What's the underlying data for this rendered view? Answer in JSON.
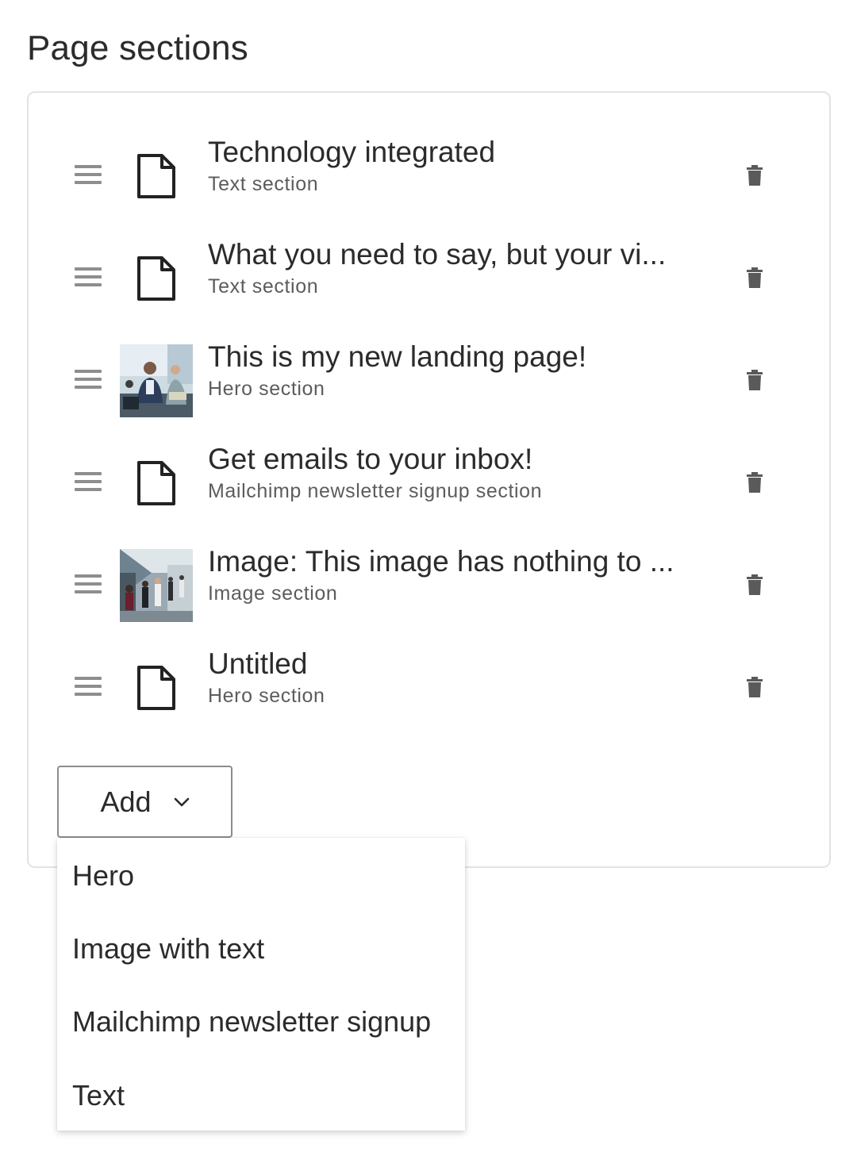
{
  "page_title": "Page sections",
  "sections": [
    {
      "title": "Technology integrated",
      "type": "Text section",
      "thumb": "page-icon"
    },
    {
      "title": "What you need to say, but your vi...",
      "type": "Text section",
      "thumb": "page-icon"
    },
    {
      "title": "This is my new landing page!",
      "type": "Hero section",
      "thumb": "photo-business-people"
    },
    {
      "title": "Get emails to your inbox!",
      "type": "Mailchimp newsletter signup section",
      "thumb": "page-icon"
    },
    {
      "title": "Image: This image has nothing to ...",
      "type": "Image section",
      "thumb": "photo-commuters"
    },
    {
      "title": "Untitled",
      "type": "Hero section",
      "thumb": "page-icon"
    }
  ],
  "add_button": {
    "label": "Add",
    "icon": "chevron-down-icon"
  },
  "dropdown": {
    "items": [
      "Hero",
      "Image with text",
      "Mailchimp newsletter signup",
      "Text"
    ]
  },
  "icons": {
    "drag": "drag-handle-icon",
    "delete": "trash-icon"
  },
  "colors": {
    "text": "#2b2b2b",
    "muted": "#5c5c5c",
    "icon": "#5a5a5a",
    "border": "#e3e3e3"
  }
}
